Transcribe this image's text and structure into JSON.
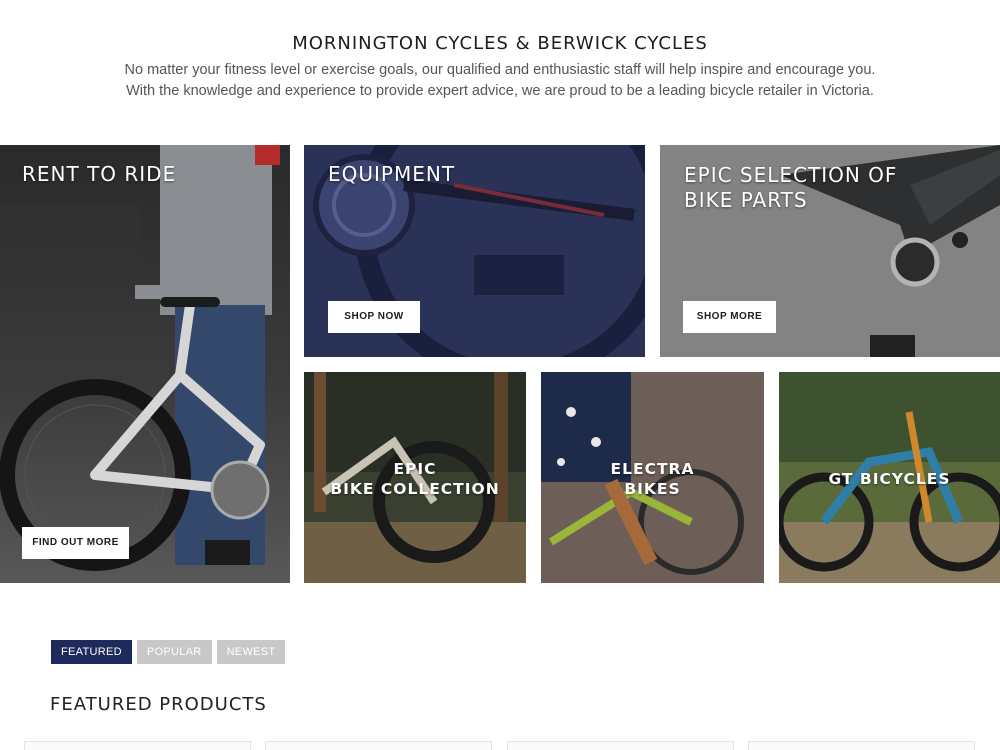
{
  "intro": {
    "title": "MORNINGTON CYCLES & BERWICK CYCLES",
    "line1": "No matter your fitness level or exercise goals, our qualified and enthusiastic staff will help inspire and encourage you.",
    "line2": "With the knowledge and experience to provide expert advice, we are proud to be a leading bicycle retailer in Victoria."
  },
  "tiles": {
    "rent": {
      "title": "RENT TO RIDE",
      "button": "FIND OUT MORE"
    },
    "equipment": {
      "title": "EQUIPMENT",
      "button": "SHOP NOW"
    },
    "parts": {
      "title_line1": "EPIC SELECTION OF",
      "title_line2": "BIKE PARTS",
      "button": "SHOP MORE"
    },
    "epic": {
      "title_line1": "EPIC",
      "title_line2": "BIKE COLLECTION"
    },
    "electra": {
      "title_line1": "ELECTRA",
      "title_line2": "BIKES"
    },
    "gt": {
      "title": "GT BICYCLES"
    }
  },
  "tabs": [
    {
      "label": "FEATURED",
      "active": true
    },
    {
      "label": "POPULAR",
      "active": false
    },
    {
      "label": "NEWEST",
      "active": false
    }
  ],
  "section": {
    "title": "FEATURED PRODUCTS"
  },
  "colors": {
    "accent": "#1f2a5c",
    "tab_inactive": "#c8c8c8"
  }
}
